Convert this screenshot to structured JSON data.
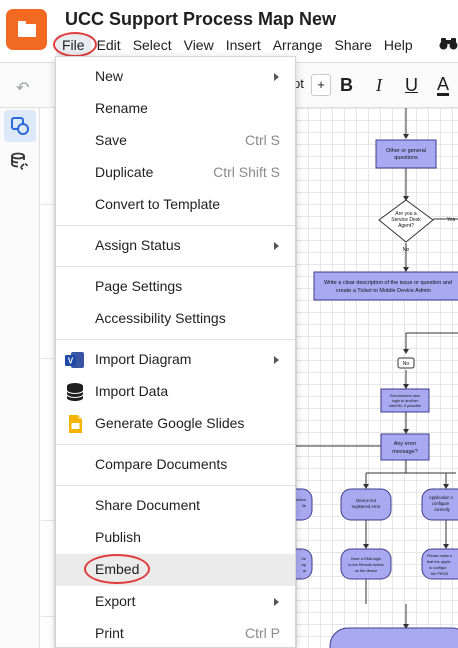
{
  "header": {
    "title": "UCC Support Process Map New",
    "menus": [
      "File",
      "Edit",
      "Select",
      "View",
      "Insert",
      "Arrange",
      "Share",
      "Help"
    ]
  },
  "toolbar": {
    "font_size_unit": "pt",
    "plus": "+",
    "bold": "B",
    "italic": "I",
    "underline": "U",
    "text_color": "A"
  },
  "file_menu": {
    "items": [
      {
        "label": "New",
        "submenu": true
      },
      {
        "label": "Rename"
      },
      {
        "label": "Save",
        "shortcut": "Ctrl S"
      },
      {
        "label": "Duplicate",
        "shortcut": "Ctrl Shift S"
      },
      {
        "label": "Convert to Template"
      },
      {
        "label": "Assign Status",
        "submenu": true
      },
      {
        "label": "Page Settings"
      },
      {
        "label": "Accessibility Settings"
      },
      {
        "label": "Import Diagram",
        "submenu": true,
        "icon": "visio-icon"
      },
      {
        "label": "Import Data",
        "icon": "database-icon"
      },
      {
        "label": "Generate Google Slides",
        "icon": "google-slides-icon"
      },
      {
        "label": "Compare Documents"
      },
      {
        "label": "Share Document"
      },
      {
        "label": "Publish"
      },
      {
        "label": "Embed",
        "highlighted": true
      },
      {
        "label": "Export",
        "submenu": true
      },
      {
        "label": "Print",
        "shortcut": "Ctrl P"
      }
    ]
  },
  "canvas": {
    "nodes": {
      "other_questions": "Other or general questions",
      "service_desk_agent": "Are you a Service Desk Agent?",
      "yes": "Yes",
      "no": "No",
      "write_description": "Write a clear description of the issue or question and create a Ticket to Mobile Device Admin",
      "no_badge": "No",
      "recommend": "Recommend user login to another site/VM, if possible",
      "any_error": "Any error message?",
      "left_box": "...ection ...ile",
      "device_not_registered": "Device not registered error",
      "application_configured": "Application not configured correctly",
      "have_dma": "Have a DMA login to the Remote Admin on the device",
      "please_make_sure": "Please make sure that the application is configured in the PROD environment",
      "left_box2": "...he ...ap ...al"
    }
  },
  "colors": {
    "accent": "#f26a21",
    "ring": "#e03c3c",
    "node_fill": "#a9a9f2",
    "node_stroke": "#3c3c8c",
    "selected_rail": "#dde8f8"
  }
}
